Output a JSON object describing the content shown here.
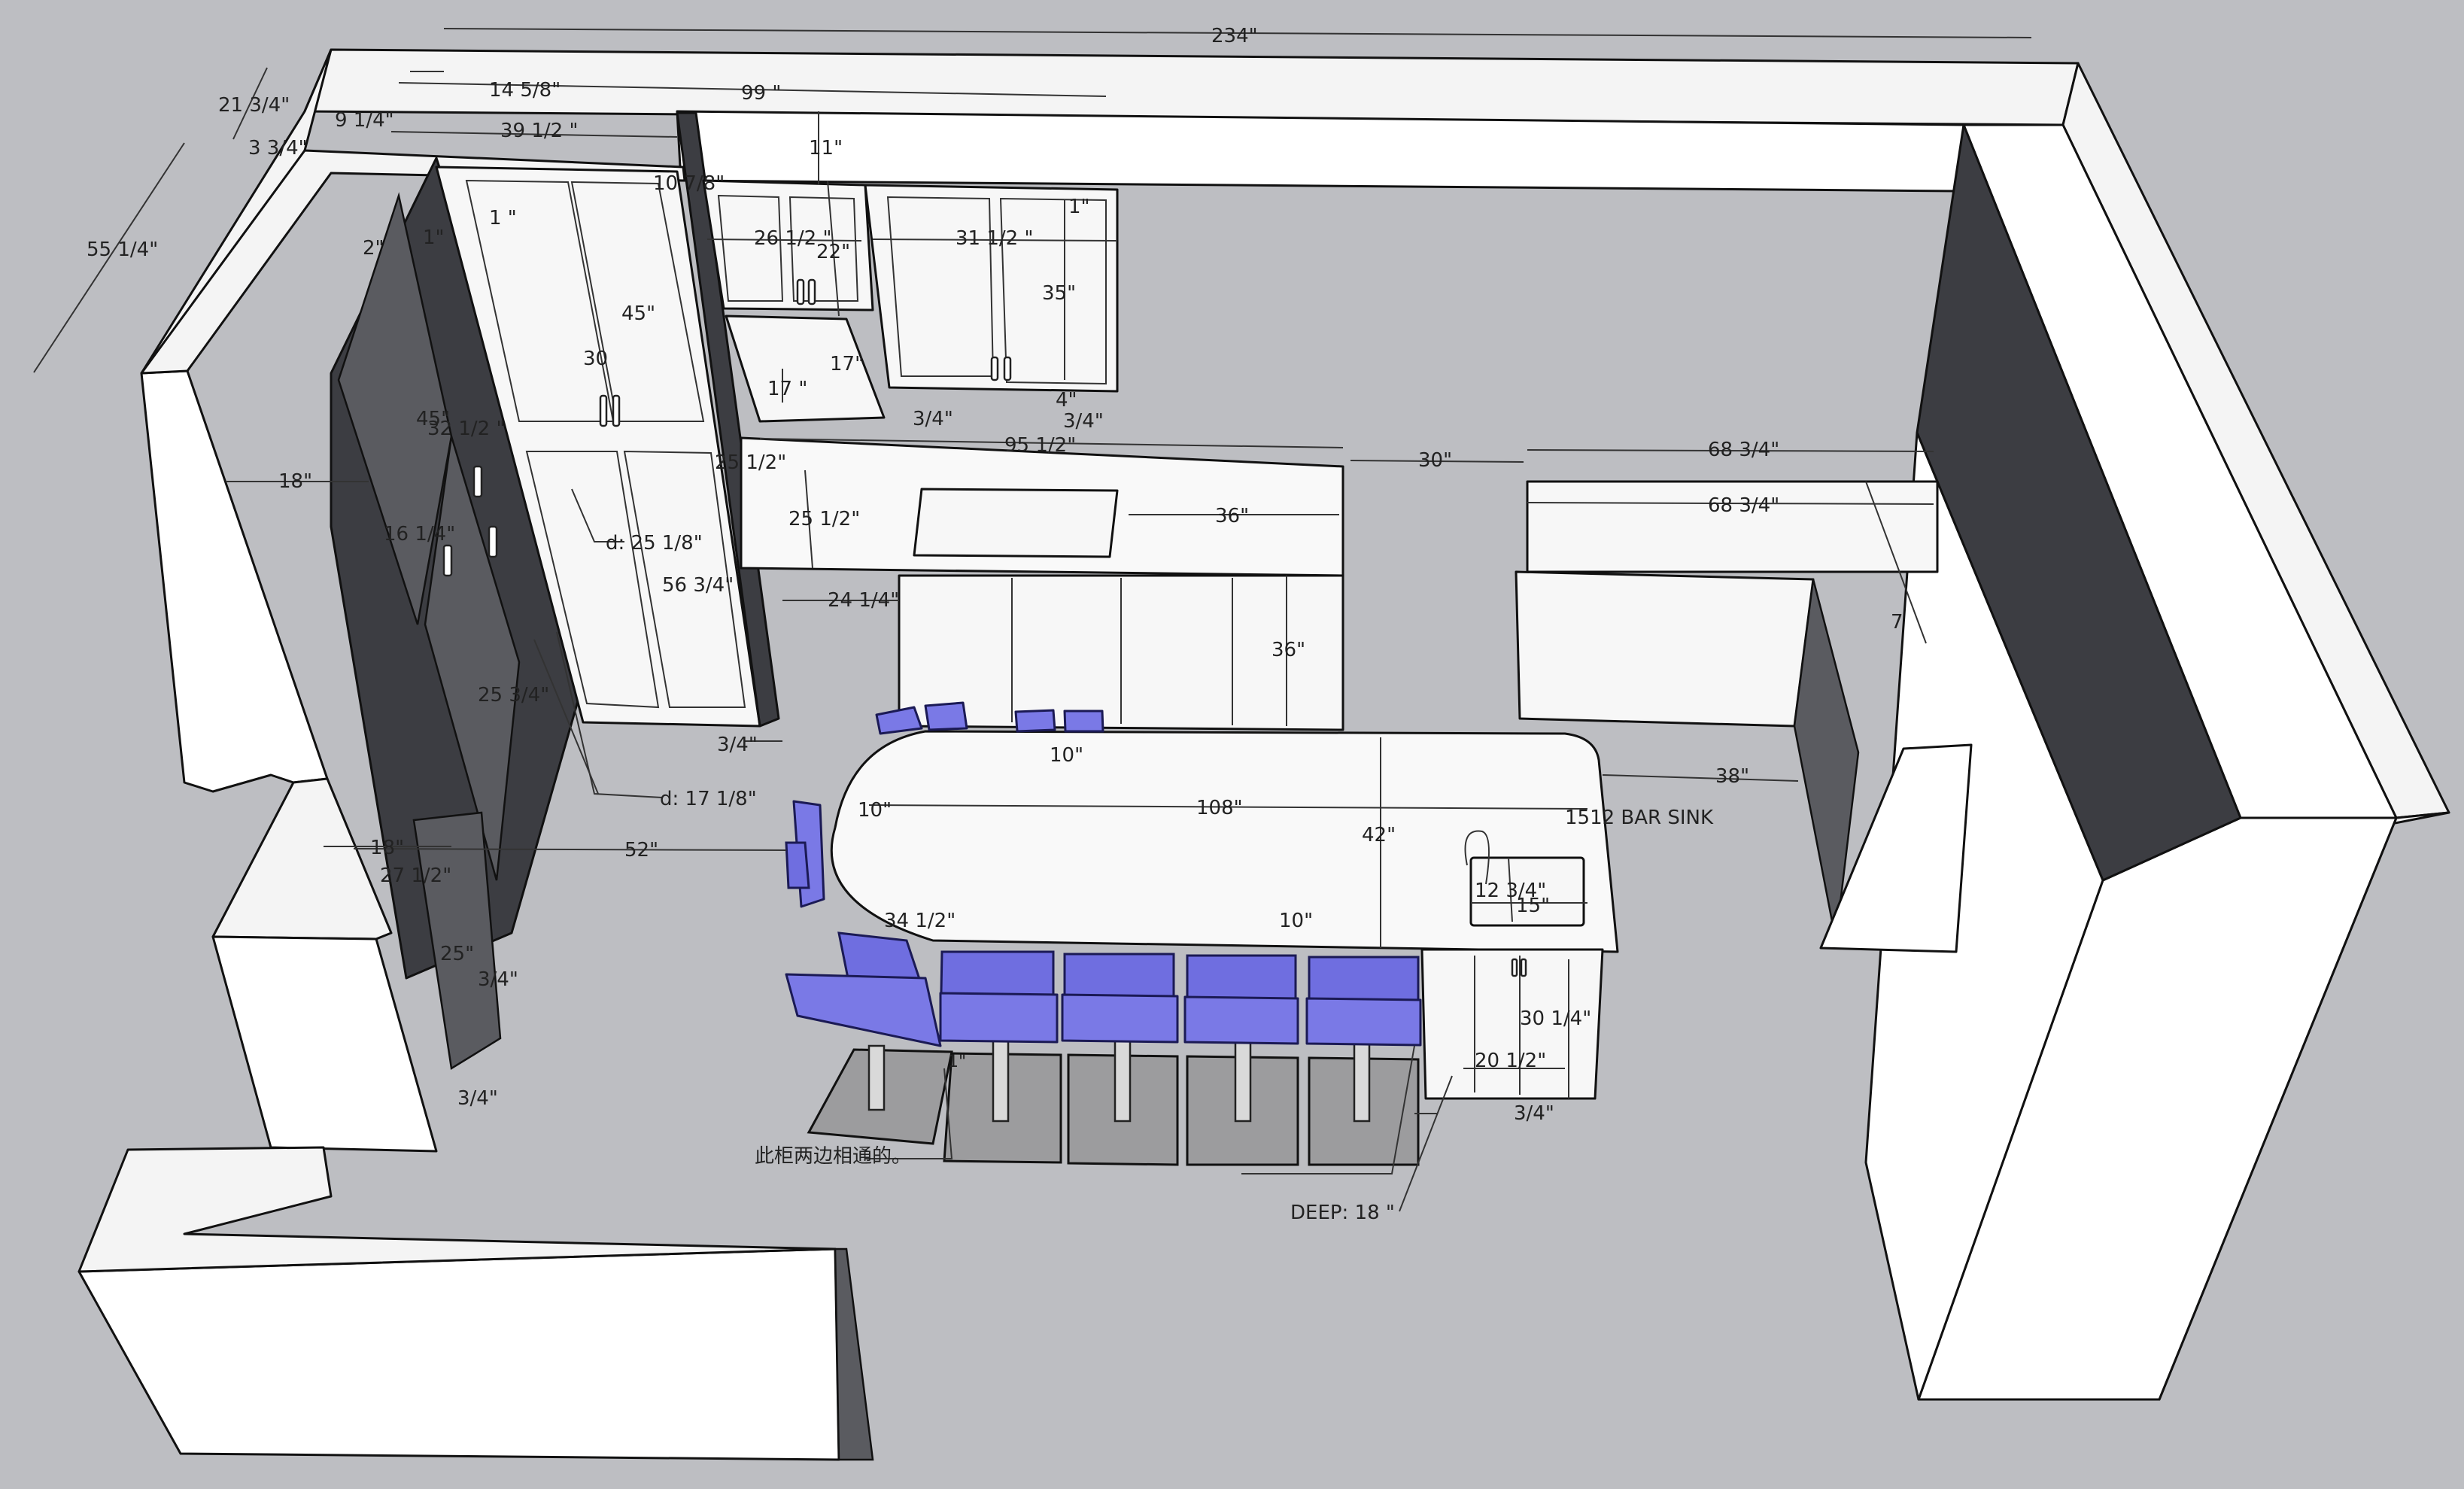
{
  "dimensions": {
    "overall_width": "234\"",
    "upper_left_width": "99 \"",
    "soffit_14": "14 5/8\"",
    "wall_21": "21 3/4\"",
    "wall_9": "9 1/4\"",
    "wall_3": "3 3/4\"",
    "pantry_width": "39 1/2 \"",
    "upper_height_11": "11\"",
    "gap_10": "10 7/8\"",
    "wall_55": "55 1/4\"",
    "trim_2": "2\"",
    "trim_1": "1\"",
    "trim_1b": "1 \"",
    "upper_26": "26 1/2 \"",
    "upper_22": "22\"",
    "upper_31": "31 1/2  \"",
    "upper_1": "1\"",
    "upper_35": "35\"",
    "door_45": "45\"",
    "door_45b": "45\"",
    "pantry_30": "30",
    "depth_32": "32 1/2 \"",
    "hood_17a": "17\"",
    "hood_17b": "17 \"",
    "gap_3_4a": "3/4\"",
    "gap_3_4b": "3/4\"",
    "gap_4": "4\"",
    "run_95": "95 1/2\"",
    "depth_25a": "25 1/2\"",
    "depth_25b": "25 1/2\"",
    "counter_36": "36\"",
    "gap_30": "30\"",
    "run_68a": "68 3/4\"",
    "run_68b": "68 3/4\"",
    "wall_18": "18\"",
    "tall_16": "16 1/4\"",
    "depth_d25": "d: 25 1/8\"",
    "tall_56": "56 3/4\"",
    "base_24": "24 1/4\"",
    "base_height_36": "36\"",
    "gap_3_4c": "3/4\"",
    "tall_25": "25 3/4\"",
    "depth_d17": "d: 17 1/8\"",
    "side_7": "7",
    "gap_38": "38\"",
    "island_length": "108\"",
    "island_10a": "10\"",
    "island_10b": "10\"",
    "island_10c": "10\"",
    "bar_sink": "1512 BAR SINK",
    "clear_52": "52\"",
    "island_depth": "42\"",
    "wall_18b": "18\"",
    "side_27": "27 1/2\"",
    "island_34": "34 1/2\"",
    "sink_12": "12 3/4\"",
    "sink_15": "15\"",
    "side_25": "25\"",
    "side_3_4a": "3/4\"",
    "side_3_4b": "3/4\"",
    "island_30": "30 1/4\"",
    "island_20": "20 1/2\"",
    "island_3_4": "3/4\"",
    "deep_18": "DEEP: 18 \"",
    "stool_note": "1\"",
    "note_cn": "此柜两边相通的。"
  },
  "colors": {
    "background": "#bdbec2",
    "stool": "#7a79e6",
    "dark_cabinet": "#3c3d42"
  }
}
